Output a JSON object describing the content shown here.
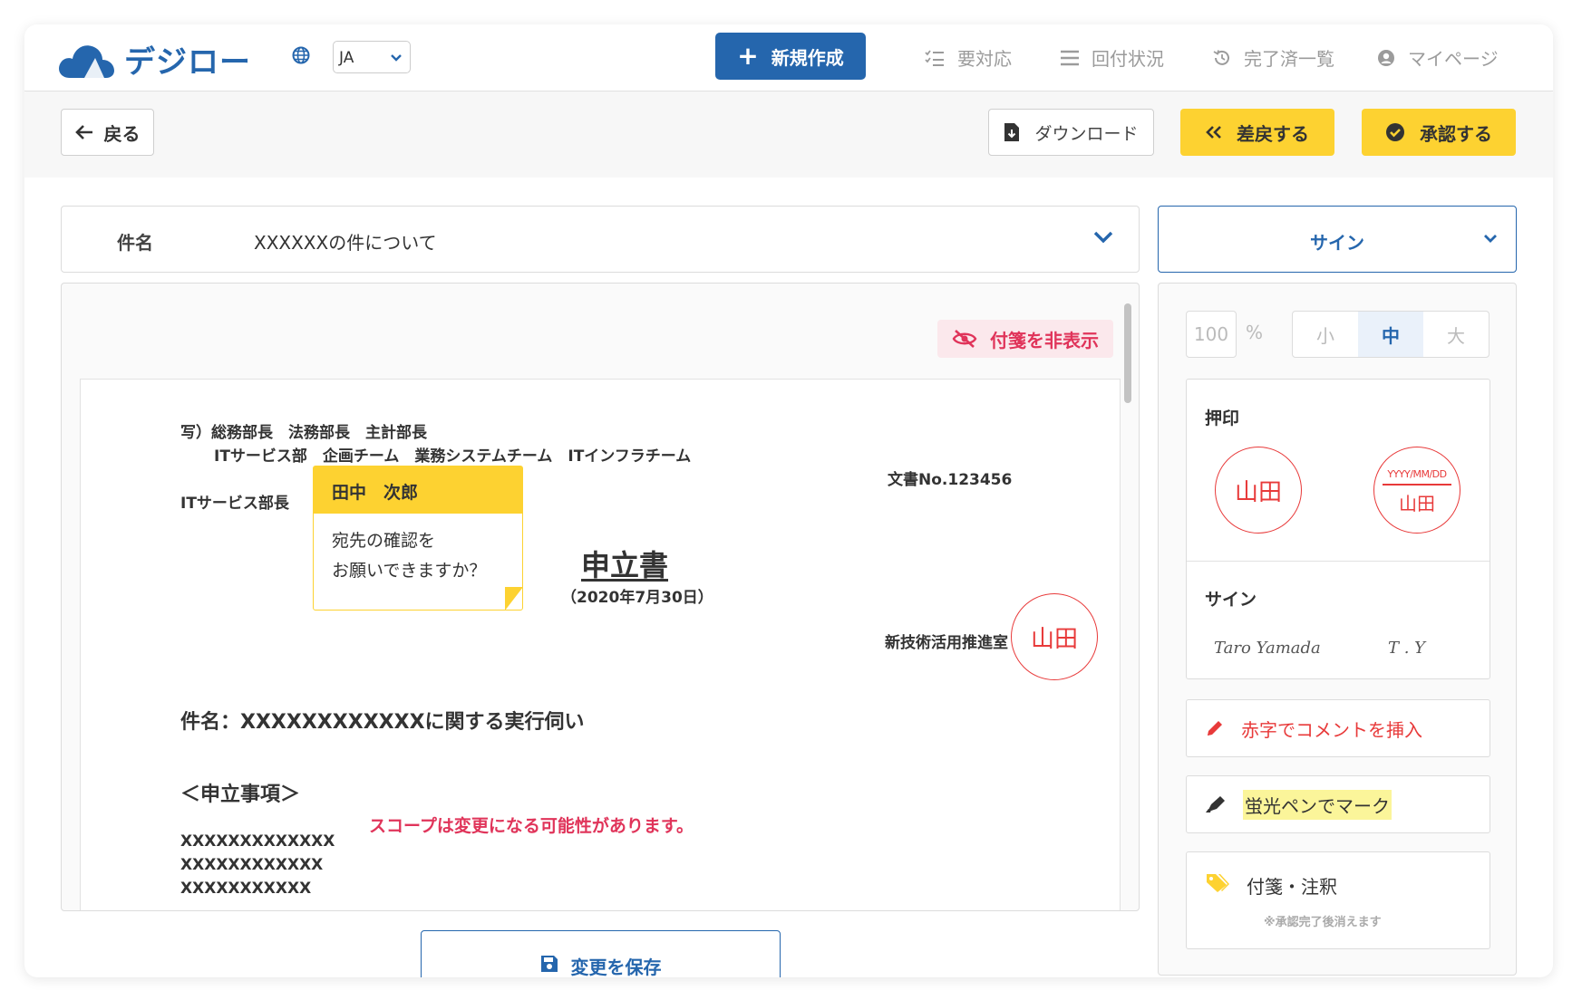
{
  "header": {
    "logo_text": "デジロー",
    "lang": "JA",
    "new_button": "新規作成",
    "nav": [
      "要対応",
      "回付状況",
      "完了済一覧",
      "マイページ"
    ]
  },
  "toolbar": {
    "back": "戻る",
    "download": "ダウンロード",
    "return": "差戻する",
    "approve": "承認する"
  },
  "subject": {
    "label": "件名",
    "value": "XXXXXXの件について"
  },
  "sign_select": "サイン",
  "viewer": {
    "hide_notes": "付箋を非表示",
    "doc": {
      "cc_line1": "写）総務部長　法務部長　主計部長",
      "cc_line2": "ITサービス部　企画チーム　業務システムチーム　ITインフラチーム",
      "to": "ITサービス部長",
      "doc_no": "文書No.123456",
      "title": "申立書",
      "date": "（2020年7月30日）",
      "from": "新技術活用推進室",
      "seal": "山田",
      "subject": "件名：XXXXXXXXXXXXに関する実行伺い",
      "section": "＜申立事項＞",
      "line1": "XXXXXXXXXXXXX",
      "line2": "XXXXXXXXXXXX",
      "line3": "XXXXXXXXXXX",
      "comment": "スコープは変更になる可能性があります。"
    },
    "note": {
      "author": "田中　次郎",
      "line1": "宛先の確認を",
      "line2": "お願いできますか？"
    }
  },
  "save_button": "変更を保存",
  "side": {
    "zoom": "100",
    "zoom_unit": "%",
    "sizes": [
      "小",
      "中",
      "大"
    ],
    "stamp_title": "押印",
    "stamp_name": "山田",
    "stamp_date": "YYYY/MM/DD",
    "sign_title": "サイン",
    "sign_full": "Taro Yamada",
    "sign_initials": "T . Y",
    "tool_red": "赤字でコメントを挿入",
    "tool_marker": "蛍光ペンでマーク",
    "tool_note": "付箋・注釈",
    "tool_note_hint": "※承認完了後消えます"
  },
  "colors": {
    "primary": "#2566ad",
    "accent_yellow": "#fdd231",
    "danger": "#e0345a",
    "seal_red": "#e83a3a"
  }
}
